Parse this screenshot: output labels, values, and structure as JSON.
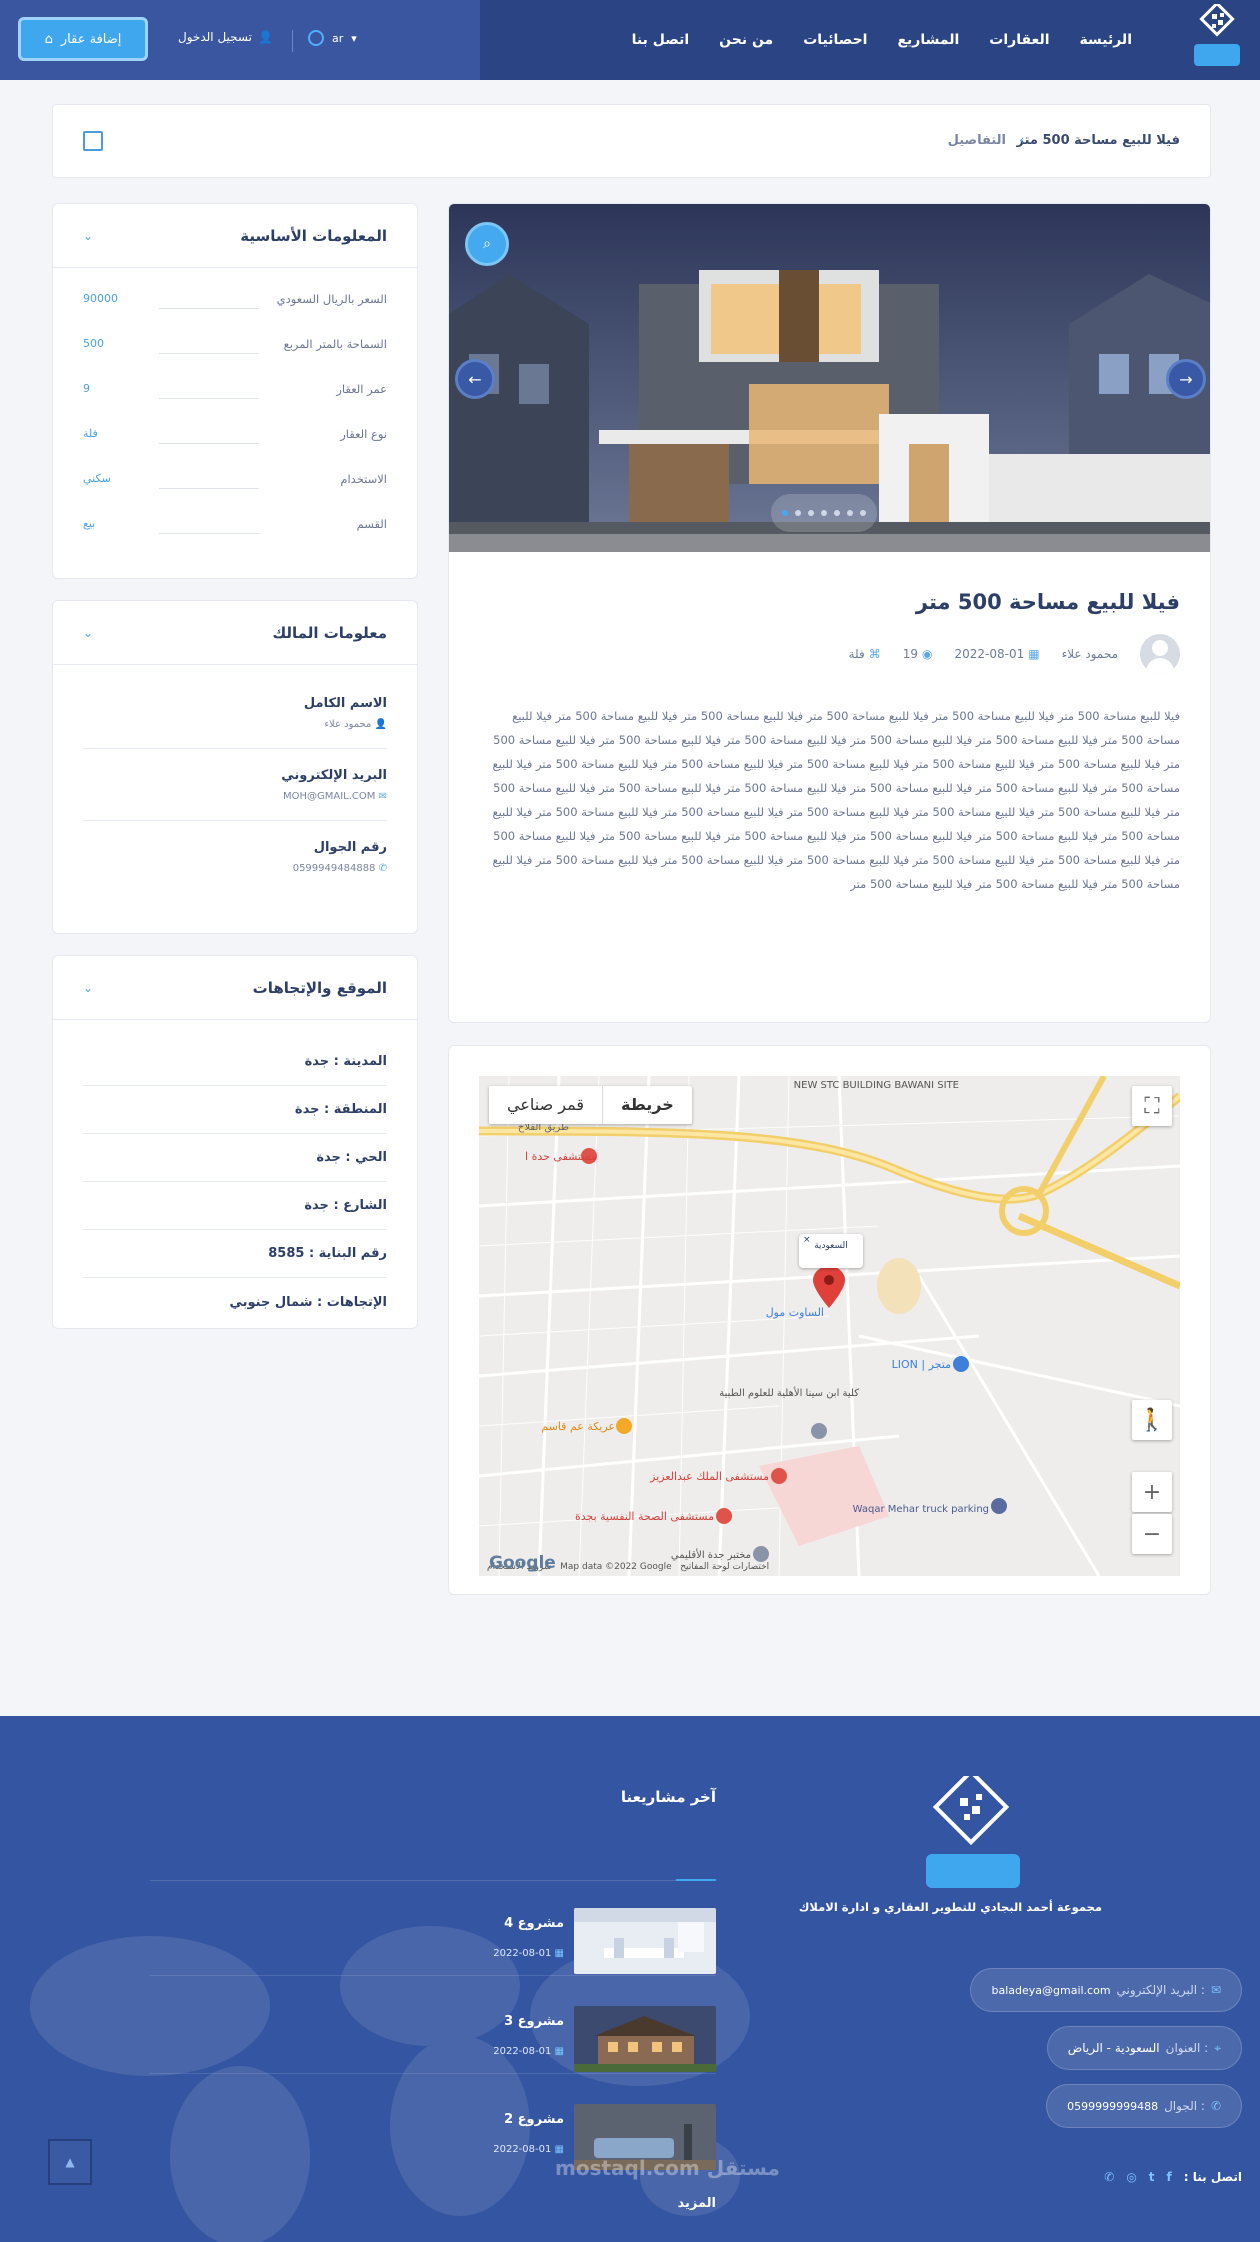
{
  "header": {
    "nav": [
      "الرئيسة",
      "العقارات",
      "المشاريع",
      "احصائيات",
      "من نحن",
      "اتصل بنا"
    ],
    "add_button": "إضافة عقار",
    "login": "تسجيل الدخول",
    "lang": "ar"
  },
  "breadcrumb": {
    "current": "فيلا للبيع مساحة 500 متر",
    "parent": "التفاصيل"
  },
  "property": {
    "title": "فيلا للبيع مساحة 500 متر",
    "author": "محمود علاء",
    "date": "2022-08-01",
    "views": "19",
    "category": "فلة",
    "description": "فيلا للبيع مساحة 500 متر فيلا للبيع مساحة 500 متر فيلا للبيع مساحة 500 متر فيلا للبيع مساحة 500 متر فيلا للبيع مساحة 500 متر فيلا للبيع مساحة 500 متر فيلا للبيع مساحة 500 متر فيلا للبيع مساحة 500 متر فيلا للبيع مساحة 500 متر فيلا للبيع مساحة 500 متر فيلا للبيع مساحة 500 متر فيلا للبيع مساحة 500 متر فيلا للبيع مساحة 500 متر فيلا للبيع مساحة 500 متر فيلا للبيع مساحة 500 متر فيلا للبيع مساحة 500 متر فيلا للبيع مساحة 500 متر فيلا للبيع مساحة 500 متر فيلا للبيع مساحة 500 متر فيلا للبيع مساحة 500 متر فيلا للبيع مساحة 500 متر فيلا للبيع مساحة 500 متر فيلا للبيع مساحة 500 متر فيلا للبيع مساحة 500 متر فيلا للبيع مساحة 500 متر فيلا للبيع مساحة 500 متر فيلا للبيع مساحة 500 متر فيلا للبيع مساحة 500 متر فيلا للبيع مساحة 500 متر فيلا للبيع مساحة 500 متر فيلا للبيع مساحة 500 متر فيلا للبيع مساحة 500 متر فيلا للبيع مساحة 500 متر فيلا للبيع مساحة 500 متر فيلا للبيع مساحة 500 متر فيلا للبيع مساحة 500 متر فيلا للبيع مساحة 500 متر فيلا للبيع مساحة 500 متر فيلا للبيع مساحة 500 متر فيلا للبيع مساحة 500 متر فيلا للبيع مساحة 500 متر"
  },
  "basic_info": {
    "heading": "المعلومات الأساسية",
    "rows": [
      {
        "k": "السعر بالريال السعودي",
        "v": "90000"
      },
      {
        "k": "السماحة بالمتر المربع",
        "v": "500"
      },
      {
        "k": "عمر العقار",
        "v": "9"
      },
      {
        "k": "نوع العقار",
        "v": "فلة"
      },
      {
        "k": "الاستخدام",
        "v": "سكني"
      },
      {
        "k": "القسم",
        "v": "بيع"
      }
    ]
  },
  "owner": {
    "heading": "معلومات المالك",
    "name_label": "الاسم الكامل",
    "name": "محمود علاء",
    "email_label": "البريد الإلكتروني",
    "email": "MOH@GMAIL.COM",
    "phone_label": "رقم الجوال",
    "phone": "0599949484888"
  },
  "location": {
    "heading": "الموقع والإتجاهات",
    "rows": [
      "المدينة : جدة",
      "المنطقة : جدة",
      "الحي : جدة",
      "الشارع : جدة",
      "رقم البناية : 8585",
      "الإتجاهات : شمال جنوبي"
    ]
  },
  "map": {
    "type_map": "خريطة",
    "type_sat": "قمر صناعي",
    "callout": "السعودية",
    "labels": {
      "road1": "طريق الفلاح",
      "hospital1": "مستشفى حدة ا",
      "mall": "الساوت مول",
      "college": "كلية ابن سينا الأهلية للعلوم الطبية",
      "rest": "عريكة عم قاسم",
      "hospital2": "مستشفى الملك عبدالعزيز",
      "hospital3": "مستشفى الصحة النفسية بجدة",
      "lab": "مختبر جدة الأقليمي",
      "lion": "متجر | LION",
      "waqar": "Waqar Mehar truck parking",
      "stc": "NEW STC BUILDING BAWANI SITE"
    },
    "google": "Google",
    "footer": "Map data ©2022 Google",
    "shortcuts": "اختصارات لوحة المفاتيح",
    "terms": "شروط الاستخدام"
  },
  "footer": {
    "slogan": "مجموعة أحمد البجادي للتطوير العقاري و ادارة الاملاك",
    "email_label": ": البريد الإلكتروني",
    "email": "baladeya@gmail.com",
    "address_label": ": العنوان",
    "address": "السعودية - الرياض",
    "phone_label": ": الجوال",
    "phone": "0599999999488",
    "contact": "اتصل بنا :",
    "recent_heading": "آخر مشاريعنا",
    "projects": [
      {
        "name": "مشروع 4",
        "date": "2022-08-01"
      },
      {
        "name": "مشروع 3",
        "date": "2022-08-01"
      },
      {
        "name": "مشروع 2",
        "date": "2022-08-01"
      }
    ],
    "more": "المزيد",
    "watermark": "مستقل mostaql.com"
  },
  "colors": {
    "primary": "#2b4584",
    "accent": "#3fa7ee",
    "footer": "#3455a1"
  }
}
